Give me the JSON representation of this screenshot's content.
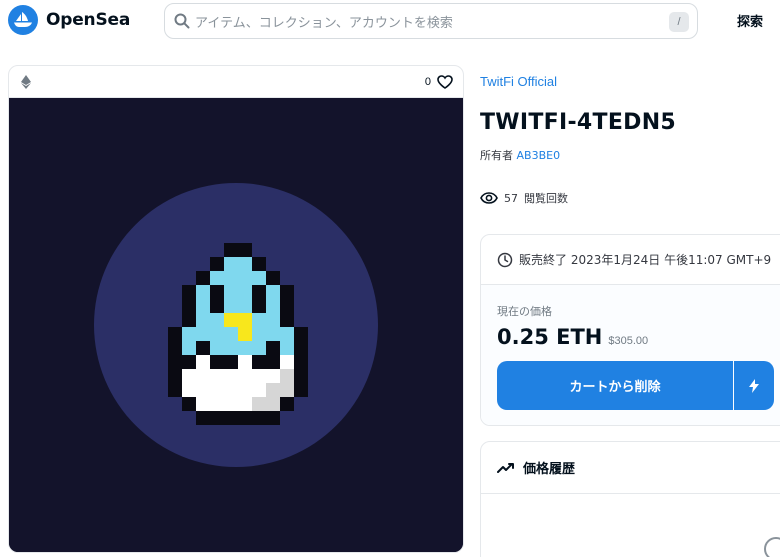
{
  "header": {
    "brand": "OpenSea",
    "search_placeholder": "アイテム、コレクション、アカウントを検索",
    "search_shortcut": "/",
    "explore_label": "探索"
  },
  "image_card": {
    "chain_icon": "ethereum-icon",
    "favorite_count": "0",
    "favorite_icon": "heart-icon"
  },
  "item": {
    "collection": "TwitFi Official",
    "title": "TWITFI-4TEDN5",
    "owner_label": "所有者",
    "owner_name": "AB3BE0",
    "views_count": "57",
    "views_label": "閲覧回数"
  },
  "sale": {
    "end_text": "販売終了 2023年1月24日 午後11:07 GMT+9",
    "current_price_label": "現在の価格",
    "price_eth": "0.25 ETH",
    "price_usd": "$305.00",
    "cart_button": "カートから削除"
  },
  "history": {
    "title": "価格履歴"
  },
  "colors": {
    "accent": "#2081e2",
    "art_background": "#13132b",
    "art_circle": "#2b2f66",
    "bird": "#7fd8ee",
    "beak": "#f8e71c"
  }
}
